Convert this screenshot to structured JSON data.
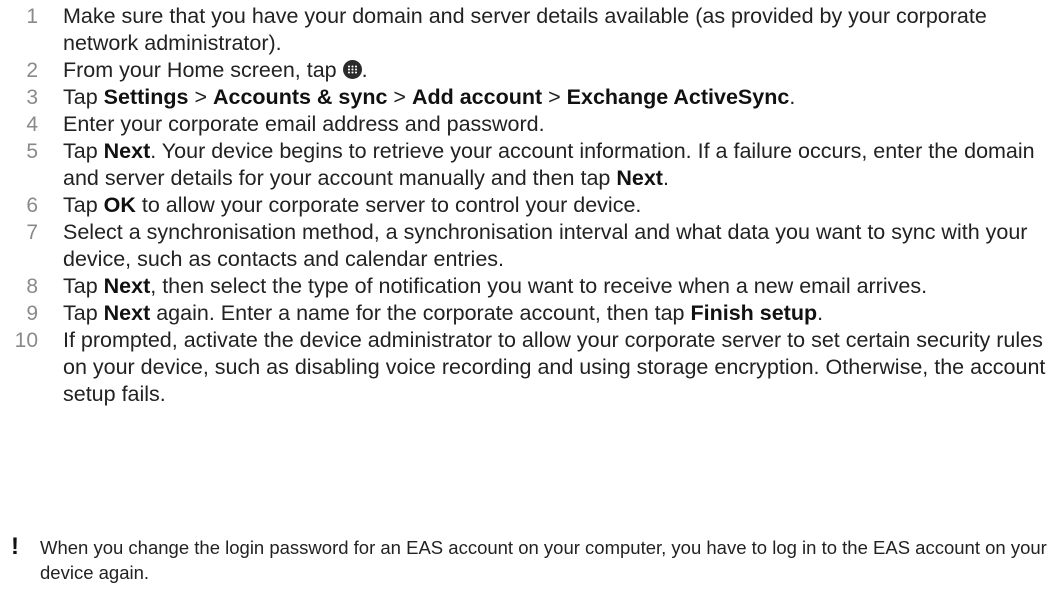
{
  "steps": [
    {
      "num": "1",
      "parts": [
        {
          "t": "Make sure that you have your domain and server details available (as provided by your corporate network administrator)."
        }
      ]
    },
    {
      "num": "2",
      "parts": [
        {
          "t": "From your Home screen, tap "
        },
        {
          "icon": "apps-icon"
        },
        {
          "t": "."
        }
      ]
    },
    {
      "num": "3",
      "parts": [
        {
          "t": "Tap "
        },
        {
          "b": "Settings"
        },
        {
          "t": " > "
        },
        {
          "b": "Accounts & sync"
        },
        {
          "t": " > "
        },
        {
          "b": "Add account"
        },
        {
          "t": " > "
        },
        {
          "b": "Exchange ActiveSync"
        },
        {
          "t": "."
        }
      ]
    },
    {
      "num": "4",
      "parts": [
        {
          "t": "Enter your corporate email address and password."
        }
      ]
    },
    {
      "num": "5",
      "parts": [
        {
          "t": "Tap "
        },
        {
          "b": "Next"
        },
        {
          "t": ". Your device begins to retrieve your account information. If a failure occurs, enter the domain and server details for your account manually and then tap "
        },
        {
          "b": "Next"
        },
        {
          "t": "."
        }
      ]
    },
    {
      "num": "6",
      "parts": [
        {
          "t": "Tap "
        },
        {
          "b": "OK"
        },
        {
          "t": " to allow your corporate server to control your device."
        }
      ]
    },
    {
      "num": "7",
      "parts": [
        {
          "t": "Select a synchronisation method, a synchronisation interval and what data you want to sync with your device, such as contacts and calendar entries."
        }
      ]
    },
    {
      "num": "8",
      "parts": [
        {
          "t": "Tap "
        },
        {
          "b": "Next"
        },
        {
          "t": ", then select the type of notification you want to receive when a new email arrives."
        }
      ]
    },
    {
      "num": "9",
      "parts": [
        {
          "t": "Tap "
        },
        {
          "b": "Next"
        },
        {
          "t": " again. Enter a name for the corporate account, then tap "
        },
        {
          "b": "Finish setup"
        },
        {
          "t": "."
        }
      ]
    },
    {
      "num": "10",
      "parts": [
        {
          "t": "If prompted, activate the device administrator to allow your corporate server to set certain security rules on your device, such as disabling voice recording and using storage encryption. Otherwise, the account setup fails."
        }
      ]
    }
  ],
  "note": {
    "icon": "exclamation-icon",
    "symbol": "!",
    "text": "When you change the login password for an EAS account on your computer, you have to log in to the EAS account on your device again."
  }
}
